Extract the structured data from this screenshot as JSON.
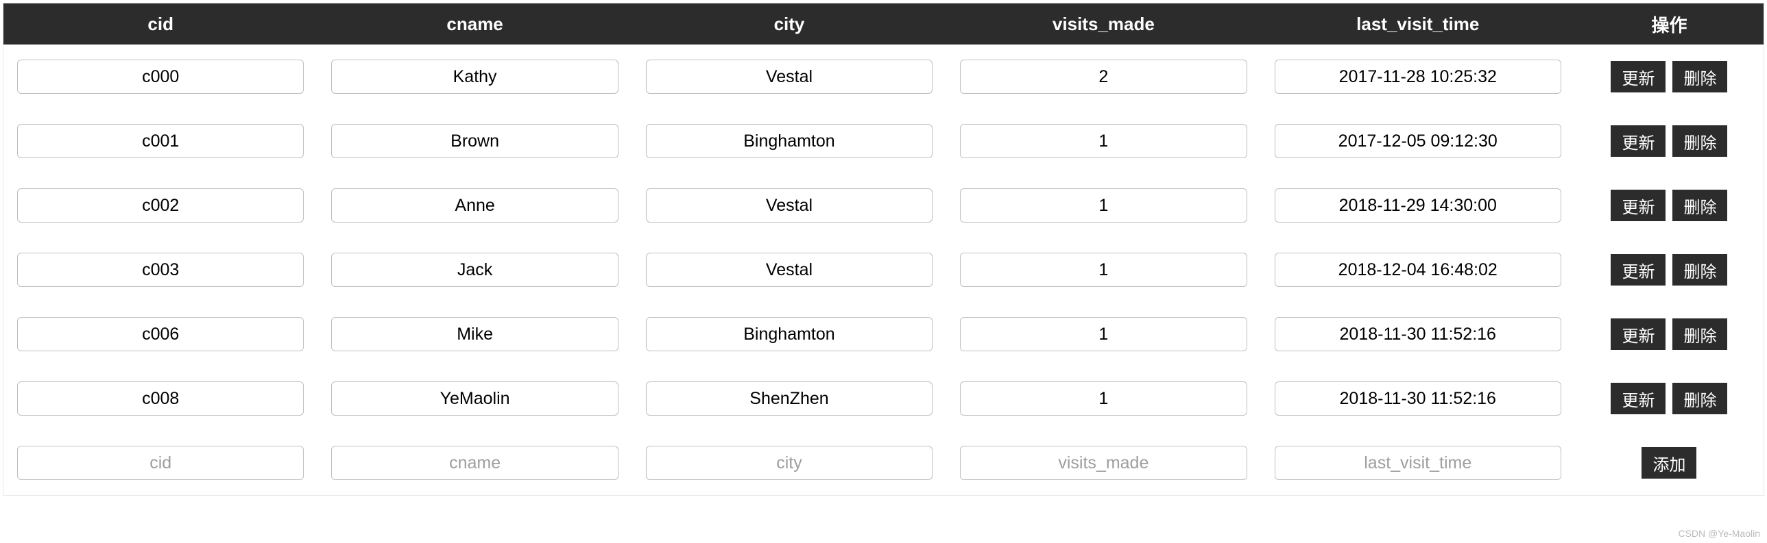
{
  "columns": [
    "cid",
    "cname",
    "city",
    "visits_made",
    "last_visit_time"
  ],
  "actions_header": "操作",
  "rows": [
    {
      "cid": "c000",
      "cname": "Kathy",
      "city": "Vestal",
      "visits_made": "2",
      "last_visit_time": "2017-11-28 10:25:32"
    },
    {
      "cid": "c001",
      "cname": "Brown",
      "city": "Binghamton",
      "visits_made": "1",
      "last_visit_time": "2017-12-05 09:12:30"
    },
    {
      "cid": "c002",
      "cname": "Anne",
      "city": "Vestal",
      "visits_made": "1",
      "last_visit_time": "2018-11-29 14:30:00"
    },
    {
      "cid": "c003",
      "cname": "Jack",
      "city": "Vestal",
      "visits_made": "1",
      "last_visit_time": "2018-12-04 16:48:02"
    },
    {
      "cid": "c006",
      "cname": "Mike",
      "city": "Binghamton",
      "visits_made": "1",
      "last_visit_time": "2018-11-30 11:52:16"
    },
    {
      "cid": "c008",
      "cname": "YeMaolin",
      "city": "ShenZhen",
      "visits_made": "1",
      "last_visit_time": "2018-11-30 11:52:16"
    }
  ],
  "add_placeholders": {
    "cid": "cid",
    "cname": "cname",
    "city": "city",
    "visits_made": "visits_made",
    "last_visit_time": "last_visit_time"
  },
  "buttons": {
    "update": "更新",
    "delete": "删除",
    "add": "添加"
  },
  "watermark": "CSDN @Ye-Maolin"
}
